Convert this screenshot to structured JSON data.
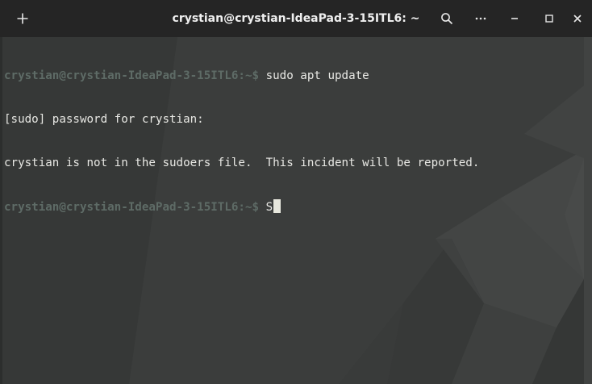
{
  "window": {
    "title": "crystian@crystian-IdeaPad-3-15ITL6: ~"
  },
  "titlebar_icons": {
    "new_tab": "plus-icon",
    "search": "search-icon",
    "menu": "hamburger-icon",
    "minimize": "minimize-icon",
    "maximize": "maximize-icon",
    "close": "close-icon"
  },
  "terminal": {
    "lines": [
      {
        "prompt": "crystian@crystian-IdeaPad-3-15ITL6:~$",
        "text": " sudo apt update"
      },
      {
        "prompt": "",
        "text": "[sudo] password for crystian:"
      },
      {
        "prompt": "",
        "text": "crystian is not in the sudoers file.  This incident will be reported."
      },
      {
        "prompt": "crystian@crystian-IdeaPad-3-15ITL6:~$",
        "text": " S"
      }
    ]
  },
  "colors": {
    "titlebar_bg": "#252525",
    "terminal_bg": "#3b3d3c",
    "prompt_color": "#5e6b66",
    "text_color": "#e8e8e4",
    "cursor_color": "#e7e7dd"
  }
}
